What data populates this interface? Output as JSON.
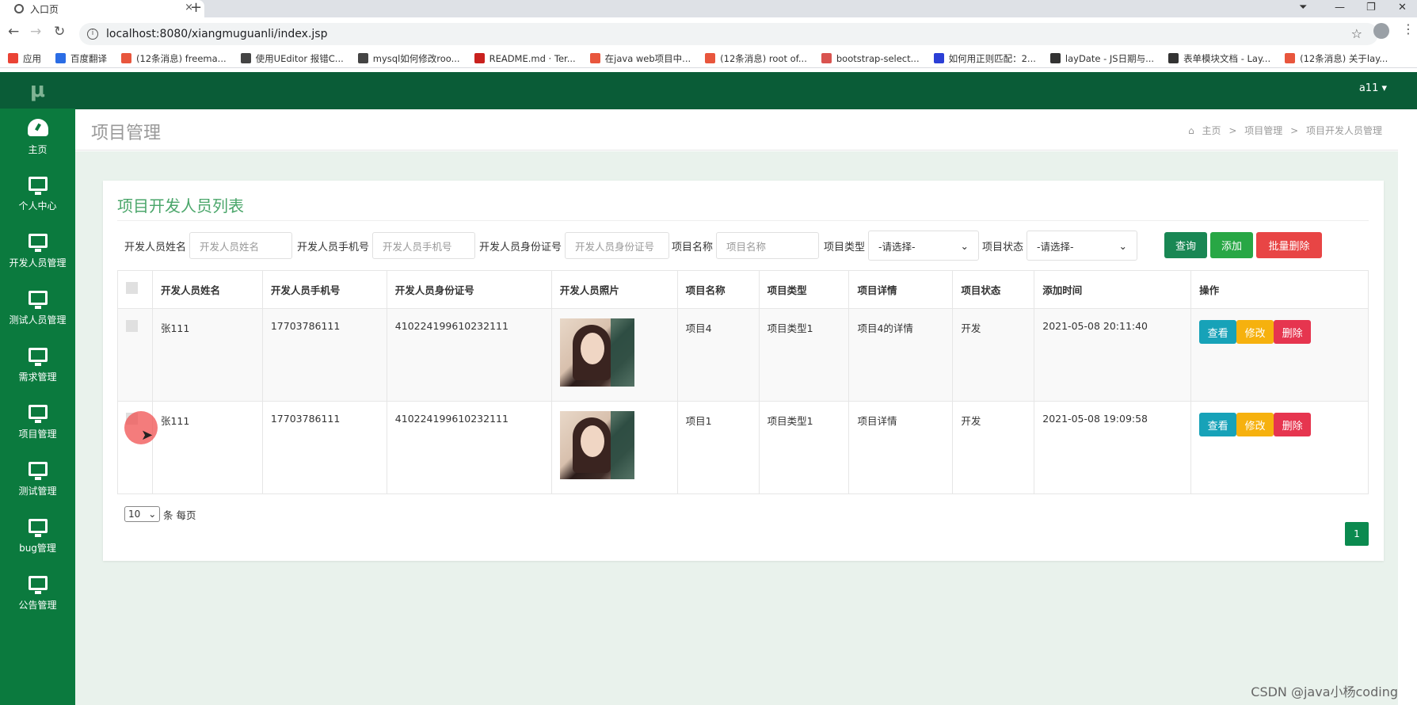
{
  "browser": {
    "tab_title": "入口页",
    "tab_close": "×",
    "new_tab": "+",
    "url": "localhost:8080/xiangmuguanli/index.jsp",
    "bookmarks": [
      {
        "label": "应用",
        "color": "#ea4335"
      },
      {
        "label": "百度翻译",
        "color": "#2b6de5"
      },
      {
        "label": "(12条消息) freema...",
        "color": "#e8563d"
      },
      {
        "label": "使用UEditor 报错C...",
        "color": "#444444"
      },
      {
        "label": "mysql如何修改roo...",
        "color": "#444444"
      },
      {
        "label": "README.md · Ter...",
        "color": "#c9211e"
      },
      {
        "label": "在java web项目中...",
        "color": "#e8563d"
      },
      {
        "label": "(12条消息) root of...",
        "color": "#e8563d"
      },
      {
        "label": "bootstrap-select...",
        "color": "#d9534f"
      },
      {
        "label": "如何用正则匹配：2...",
        "color": "#2b3fd6"
      },
      {
        "label": "layDate - JS日期与...",
        "color": "#333333"
      },
      {
        "label": "表单模块文档 - Lay...",
        "color": "#333333"
      },
      {
        "label": "(12条消息) 关于lay...",
        "color": "#e8563d"
      }
    ]
  },
  "app": {
    "logo": "μ",
    "user": "a11 ▾",
    "sidebar": [
      {
        "label": "主页",
        "icon": "dashboard-icon"
      },
      {
        "label": "个人中心",
        "icon": "monitor-icon"
      },
      {
        "label": "开发人员管理",
        "icon": "monitor-icon"
      },
      {
        "label": "测试人员管理",
        "icon": "monitor-icon"
      },
      {
        "label": "需求管理",
        "icon": "monitor-icon"
      },
      {
        "label": "项目管理",
        "icon": "monitor-icon"
      },
      {
        "label": "测试管理",
        "icon": "monitor-icon"
      },
      {
        "label": "bug管理",
        "icon": "monitor-icon"
      },
      {
        "label": "公告管理",
        "icon": "monitor-icon"
      }
    ],
    "page_title": "项目管理",
    "breadcrumb": {
      "home": "主页",
      "sep": ">",
      "level1": "项目管理",
      "level2": "项目开发人员管理"
    },
    "card_title": "项目开发人员列表",
    "filters": {
      "name_label": "开发人员姓名",
      "name_placeholder": "开发人员姓名",
      "phone_label": "开发人员手机号",
      "phone_placeholder": "开发人员手机号",
      "id_label": "开发人员身份证号",
      "id_placeholder": "开发人员身份证号",
      "project_label": "项目名称",
      "project_placeholder": "项目名称",
      "type_label": "项目类型",
      "type_value": "-请选择-",
      "status_label": "项目状态",
      "status_value": "-请选择-"
    },
    "buttons": {
      "search": "查询",
      "add": "添加",
      "batch_delete": "批量删除"
    },
    "colors": {
      "search": "#198754",
      "add": "#28a745",
      "batch_delete": "#e84545",
      "view": "#17a2b8",
      "edit": "#f6b10e",
      "delete": "#e6354f",
      "sidebar": "#0b7a3e",
      "topbar": "#0a5c37"
    },
    "table": {
      "headers": [
        "开发人员姓名",
        "开发人员手机号",
        "开发人员身份证号",
        "开发人员照片",
        "项目名称",
        "项目类型",
        "项目详情",
        "项目状态",
        "添加时间",
        "操作"
      ],
      "rows": [
        {
          "name": "张111",
          "phone": "17703786111",
          "idcard": "410224199610232111",
          "project": "项目4",
          "type": "项目类型1",
          "detail": "项目4的详情",
          "status": "开发",
          "time": "2021-05-08 20:11:40"
        },
        {
          "name": "张111",
          "phone": "17703786111",
          "idcard": "410224199610232111",
          "project": "项目1",
          "type": "项目类型1",
          "detail": "项目详情",
          "status": "开发",
          "time": "2021-05-08 19:09:58"
        }
      ],
      "actions": {
        "view": "查看",
        "edit": "修改",
        "delete": "删除"
      }
    },
    "pagesize": {
      "value": "10",
      "suffix": "条 每页"
    },
    "page_number": "1"
  },
  "watermark": "CSDN @java小杨coding"
}
